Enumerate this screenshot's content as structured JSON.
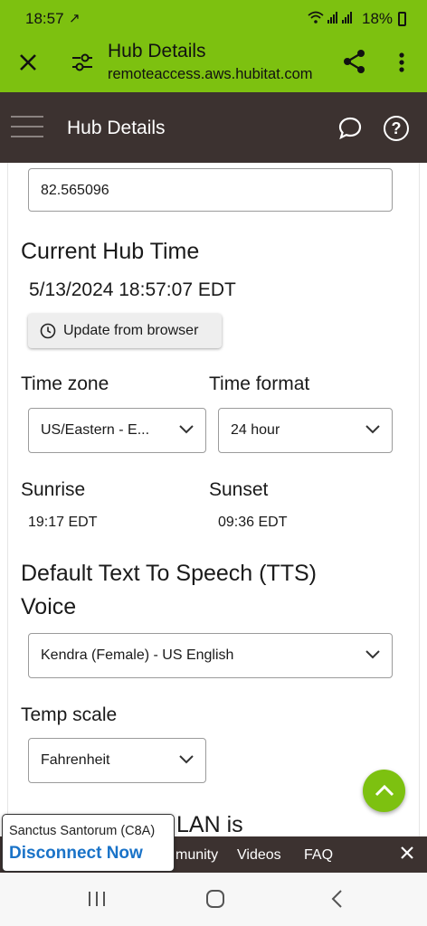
{
  "status_bar": {
    "time": "18:57",
    "battery": "18%"
  },
  "browser": {
    "title": "Hub Details",
    "url": "remoteaccess.aws.hubitat.com"
  },
  "app_bar": {
    "title": "Hub Details",
    "help_glyph": "?"
  },
  "main": {
    "longitude_value": "82.565096",
    "current_hub_time_heading": "Current Hub Time",
    "current_hub_time": "5/13/2024 18:57:07 EDT",
    "update_button_label": "Update from browser",
    "time_zone_label": "Time zone",
    "time_zone_value": "US/Eastern - E...",
    "time_format_label": "Time format",
    "time_format_value": "24 hour",
    "sunrise_label": "Sunrise",
    "sunrise_value": "19:17 EDT",
    "sunset_label": "Sunset",
    "sunset_value": "09:36 EDT",
    "tts_heading_line1": "Default Text To Speech (TTS)",
    "tts_heading_line2": "Voice",
    "tts_value": "Kendra (Female) - US English",
    "temp_scale_label": "Temp scale",
    "temp_scale_value": "Fahrenheit",
    "partial_heading": "LAN is"
  },
  "footer": {
    "community_partial": "munity",
    "videos": "Videos",
    "faq": "FAQ"
  },
  "toast": {
    "hub_name": "Sanctus Santorum (C8A)",
    "disconnect_label": "Disconnect Now"
  },
  "colors": {
    "accent_green": "#7dc110",
    "header_dark": "#3c3230",
    "link_blue": "#1a73c8"
  },
  "icons": [
    "close-icon",
    "tune-icon",
    "share-icon",
    "more-vert-icon",
    "menu-icon",
    "chat-icon",
    "help-icon",
    "clock-icon",
    "chevron-down-icon",
    "chevron-up-icon",
    "recents-icon",
    "home-icon",
    "back-icon"
  ]
}
